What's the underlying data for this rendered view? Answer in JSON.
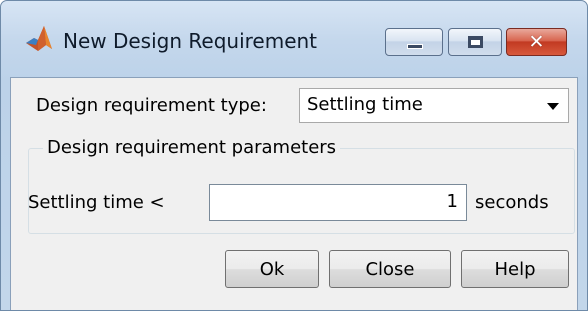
{
  "window": {
    "title": "New Design Requirement",
    "icon": "matlab-icon",
    "controls": {
      "minimize": "minimize-icon",
      "maximize": "maximize-icon",
      "close": "✕"
    }
  },
  "form": {
    "type_label": "Design requirement type:",
    "type_value": "Settling time",
    "group_title": "Design requirement parameters",
    "settling_label": "Settling time <",
    "settling_value": "1",
    "unit_label": "seconds"
  },
  "buttons": {
    "ok": "Ok",
    "close": "Close",
    "help": "Help"
  }
}
